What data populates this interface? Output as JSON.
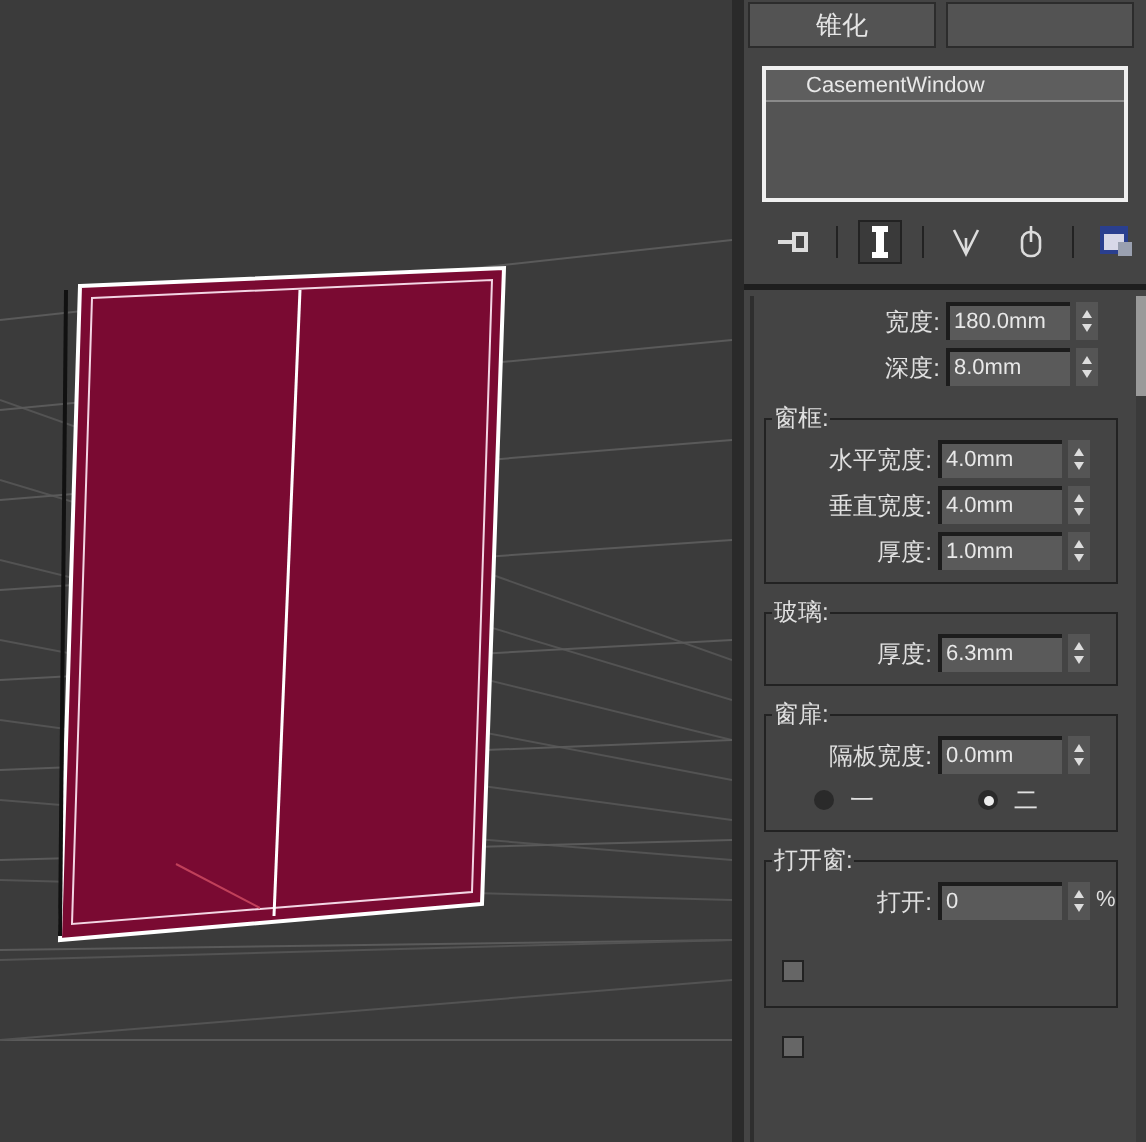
{
  "modifier_buttons": [
    {
      "label": "锥化"
    }
  ],
  "modifier_stack": [
    {
      "label": "CasementWindow",
      "selected": true
    }
  ],
  "stack_toolbar": [
    {
      "kind": "pin",
      "on": false
    },
    {
      "kind": "end_result",
      "on": true
    },
    {
      "kind": "unique",
      "on": false
    },
    {
      "kind": "remove",
      "on": false
    },
    {
      "kind": "configure",
      "on": false
    }
  ],
  "parameters": {
    "fields": [
      {
        "label": "宽度:",
        "value": "180.0mm"
      },
      {
        "label": "深度:",
        "value": "8.0mm"
      }
    ],
    "groups": [
      {
        "title": "窗框:",
        "fields": [
          {
            "label": "水平宽度:",
            "value": "4.0mm"
          },
          {
            "label": "垂直宽度:",
            "value": "4.0mm"
          },
          {
            "label": "厚度:",
            "value": "1.0mm"
          }
        ]
      },
      {
        "title": "玻璃:",
        "fields": [
          {
            "label": "厚度:",
            "value": "6.3mm"
          }
        ]
      },
      {
        "title": "窗扉:",
        "fields": [
          {
            "label": "隔板宽度:",
            "value": "0.0mm"
          }
        ],
        "radios": [
          {
            "label": "一",
            "selected": false
          },
          {
            "label": "二",
            "selected": true
          }
        ]
      },
      {
        "title": "打开窗:",
        "fields": [
          {
            "label": "打开:",
            "value": "0",
            "unit": "%"
          }
        ],
        "checkboxes": [
          {
            "checked": false
          }
        ]
      }
    ],
    "extra_checkboxes": [
      {
        "checked": false
      }
    ]
  }
}
